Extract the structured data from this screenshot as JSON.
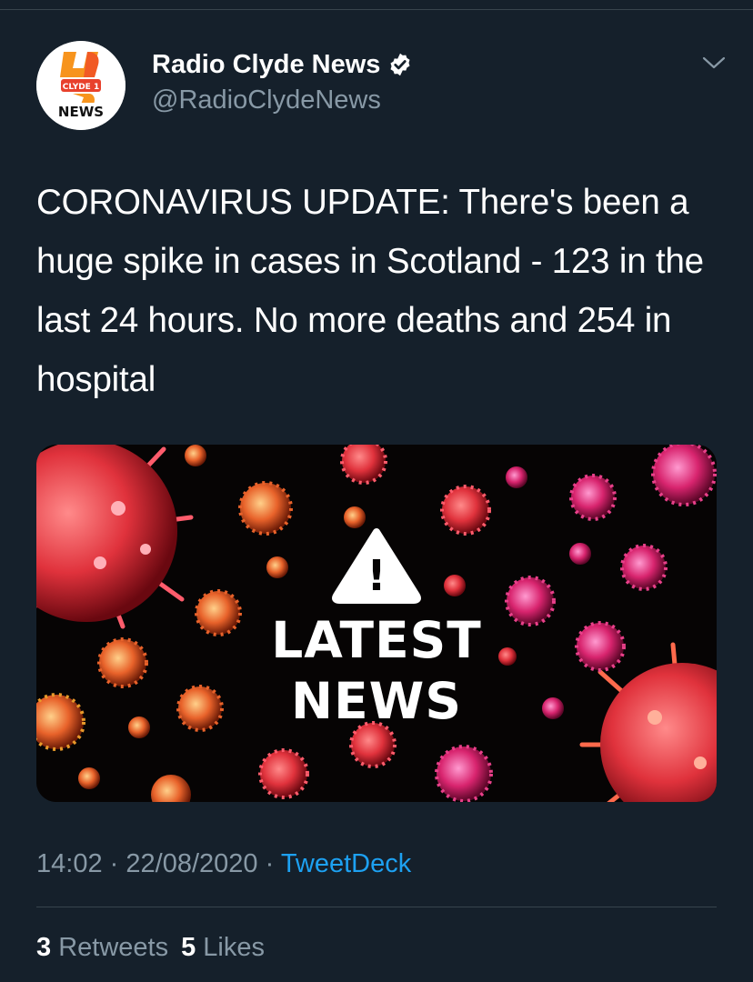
{
  "tweet": {
    "author": {
      "display_name": "Radio Clyde News",
      "handle": "@RadioClydeNews",
      "verified": true,
      "avatar_logo_text": [
        "CLYDE 1",
        "NEWS"
      ]
    },
    "text": "CORONAVIRUS UPDATE: There's been a huge spike in cases in Scotland - 123 in the last 24 hours. No more deaths and 254 in hospital",
    "media": {
      "line1": "LATEST",
      "line2": "NEWS",
      "warning_glyph": "!"
    },
    "meta": {
      "time": "14:02",
      "separator": "·",
      "date": "22/08/2020",
      "source": "TweetDeck"
    },
    "stats": {
      "retweets_count": "3",
      "retweets_label": "Retweets",
      "likes_count": "5",
      "likes_label": "Likes"
    }
  },
  "icons": {
    "verified": "verified-badge-icon",
    "menu": "chevron-down-icon",
    "warning": "warning-triangle-icon"
  },
  "colors": {
    "background": "#15202b",
    "secondary_text": "#8899a6",
    "link": "#1da1f2",
    "divider": "#38444d"
  }
}
